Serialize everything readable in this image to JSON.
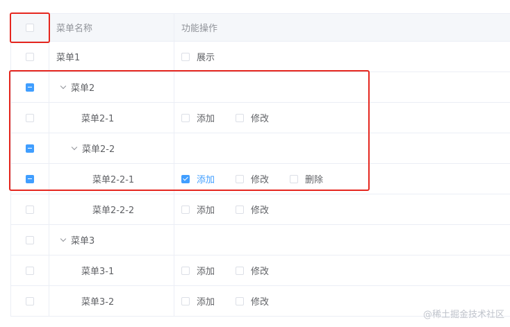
{
  "header": {
    "name": "菜单名称",
    "actions": "功能操作"
  },
  "rows": [
    {
      "name": "菜单1",
      "level": 0,
      "expandable": false,
      "state": "none",
      "perms": [
        {
          "label": "展示",
          "checked": false
        }
      ]
    },
    {
      "name": "菜单2",
      "level": 0,
      "expandable": true,
      "state": "indeterminate",
      "perms": []
    },
    {
      "name": "菜单2-1",
      "level": 1,
      "expandable": false,
      "state": "none",
      "perms": [
        {
          "label": "添加",
          "checked": false
        },
        {
          "label": "修改",
          "checked": false
        }
      ]
    },
    {
      "name": "菜单2-2",
      "level": 1,
      "expandable": true,
      "state": "indeterminate",
      "perms": []
    },
    {
      "name": "菜单2-2-1",
      "level": 2,
      "expandable": false,
      "state": "indeterminate",
      "perms": [
        {
          "label": "添加",
          "checked": true
        },
        {
          "label": "修改",
          "checked": false
        },
        {
          "label": "删除",
          "checked": false
        }
      ]
    },
    {
      "name": "菜单2-2-2",
      "level": 2,
      "expandable": false,
      "state": "none",
      "perms": [
        {
          "label": "添加",
          "checked": false
        },
        {
          "label": "修改",
          "checked": false
        }
      ]
    },
    {
      "name": "菜单3",
      "level": 0,
      "expandable": true,
      "state": "none",
      "perms": []
    },
    {
      "name": "菜单3-1",
      "level": 1,
      "expandable": false,
      "state": "none",
      "perms": [
        {
          "label": "添加",
          "checked": false
        },
        {
          "label": "修改",
          "checked": false
        }
      ]
    },
    {
      "name": "菜单3-2",
      "level": 1,
      "expandable": false,
      "state": "none",
      "perms": [
        {
          "label": "添加",
          "checked": false
        },
        {
          "label": "修改",
          "checked": false
        }
      ]
    }
  ],
  "watermark": "@稀土掘金技术社区"
}
